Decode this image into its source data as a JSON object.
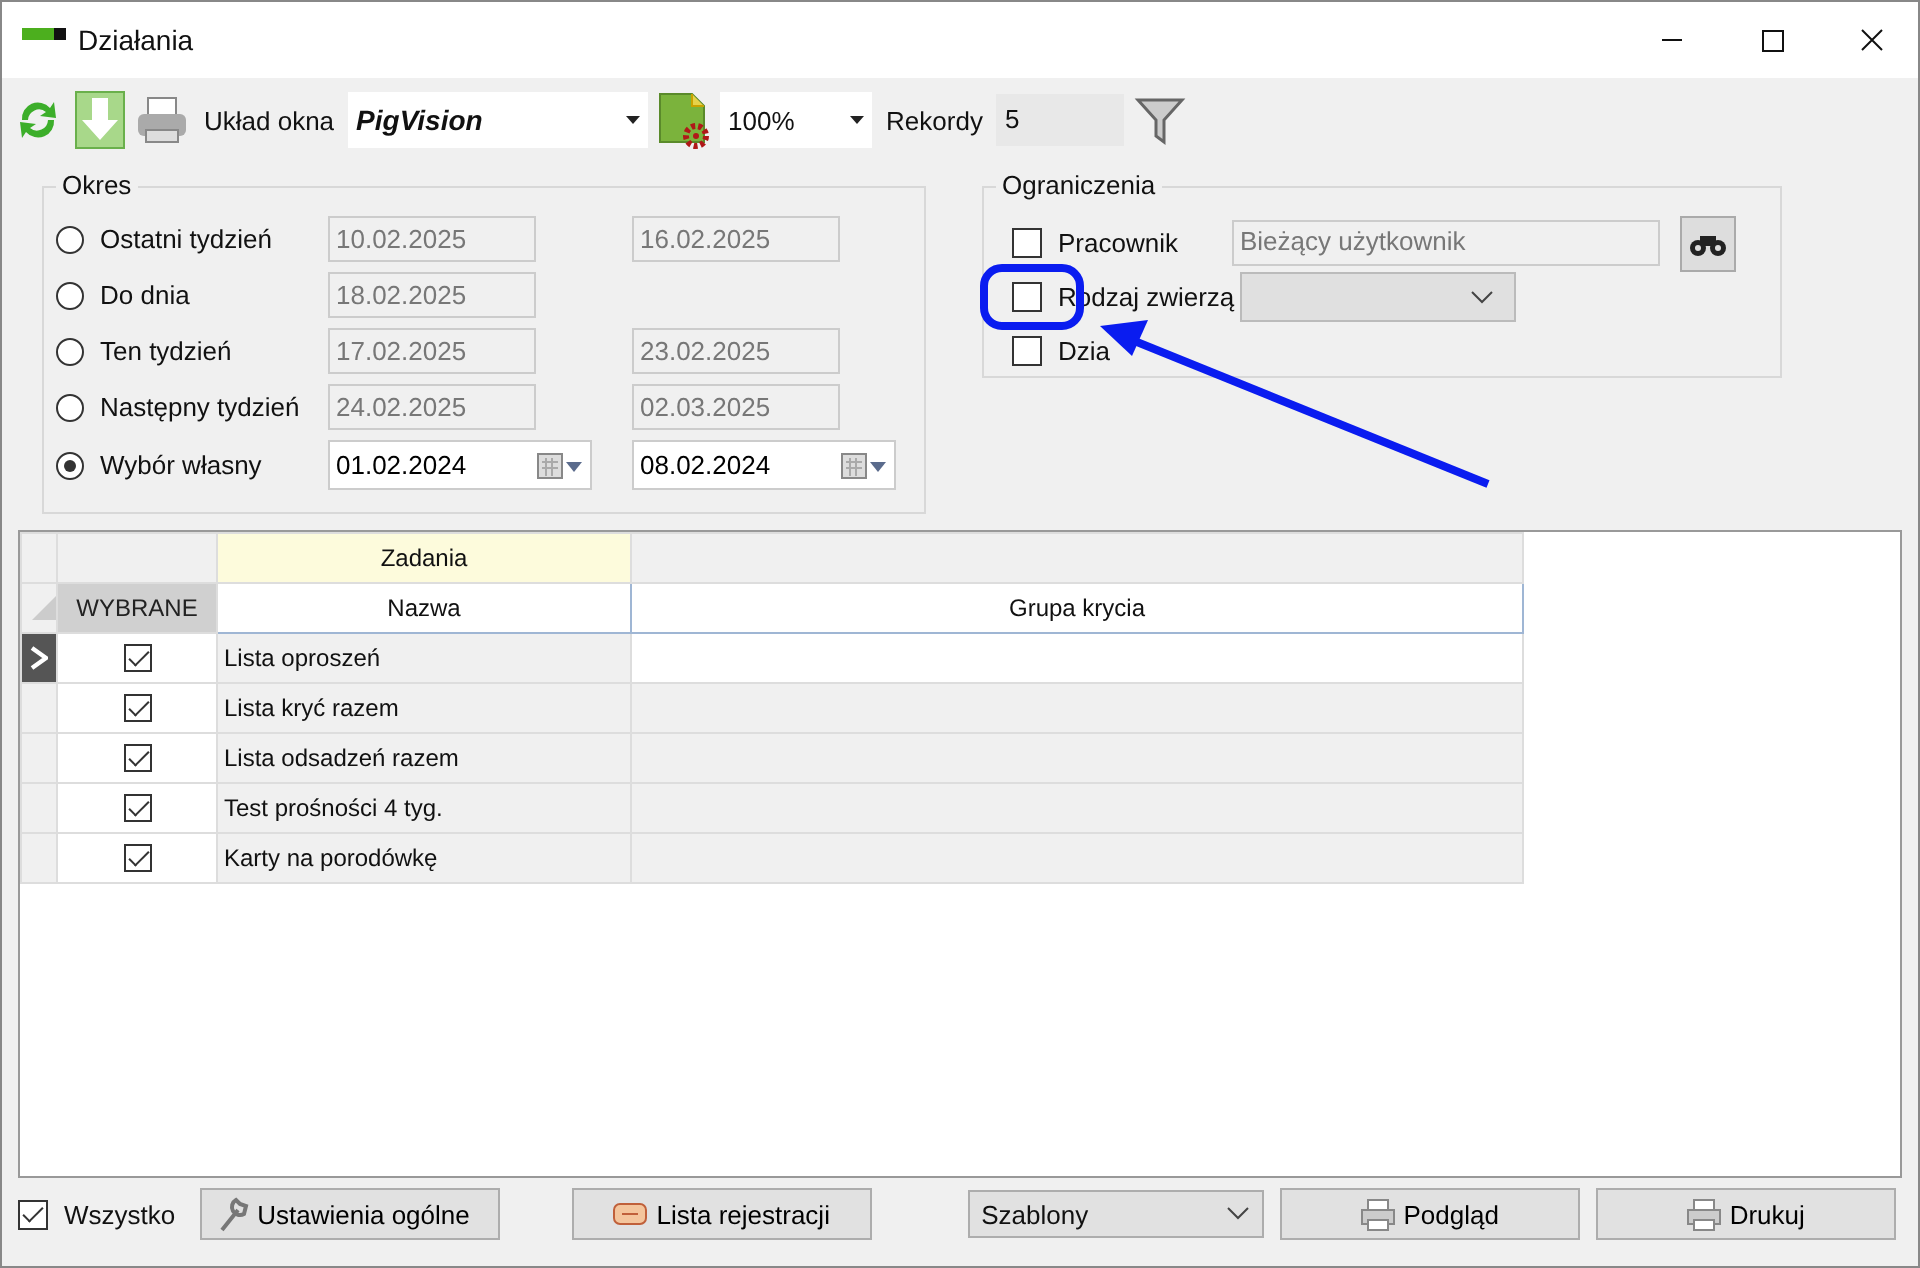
{
  "window": {
    "title": "Działania"
  },
  "toolbar": {
    "layout_label": "Układ okna",
    "layout_value": "PigVision",
    "zoom": "100%",
    "records_label": "Rekordy",
    "records": "5"
  },
  "period": {
    "title": "Okres",
    "options": [
      {
        "label": "Ostatni tydzień",
        "selected": false,
        "from": {
          "value": "10.02.2025",
          "disabled": true
        },
        "to": {
          "value": "16.02.2025",
          "disabled": true
        }
      },
      {
        "label": "Do dnia",
        "selected": false,
        "from": {
          "value": "18.02.2025",
          "disabled": true
        }
      },
      {
        "label": "Ten tydzień",
        "selected": false,
        "from": {
          "value": "17.02.2025",
          "disabled": true
        },
        "to": {
          "value": "23.02.2025",
          "disabled": true
        }
      },
      {
        "label": "Następny tydzień",
        "selected": false,
        "from": {
          "value": "24.02.2025",
          "disabled": true
        },
        "to": {
          "value": "02.03.2025",
          "disabled": true
        }
      },
      {
        "label": "Wybór własny",
        "selected": true,
        "from": {
          "value": "01.02.2024",
          "disabled": false
        },
        "to": {
          "value": "08.02.2024",
          "disabled": false
        }
      }
    ]
  },
  "limits": {
    "title": "Ograniczenia",
    "items": [
      {
        "kind": "text",
        "label": "Pracownik",
        "checked": false,
        "value": "Bieżący użytkownik"
      },
      {
        "kind": "combo",
        "label": "Rodzaj zwierzą",
        "checked": false
      },
      {
        "kind": "plain",
        "label": "Dzia",
        "checked": false
      }
    ]
  },
  "grid": {
    "group_header": "Zadania",
    "columns": [
      "WYBRANE",
      "Nazwa",
      "Grupa krycia"
    ],
    "rows": [
      {
        "selected": true,
        "checked": true,
        "name": "Lista oproszeń"
      },
      {
        "selected": false,
        "checked": true,
        "name": "Lista kryć razem"
      },
      {
        "selected": false,
        "checked": true,
        "name": "Lista odsadzeń razem"
      },
      {
        "selected": false,
        "checked": true,
        "name": "Test prośności 4 tyg."
      },
      {
        "selected": false,
        "checked": true,
        "name": "Karty na porodówkę"
      }
    ]
  },
  "footer": {
    "all_label": "Wszystko",
    "all_checked": true,
    "settings_button": "Ustawienia ogólne",
    "log_button": "Lista rejestracji",
    "templates": "Szablony",
    "preview_button": "Podgląd",
    "print_button": "Drukuj"
  }
}
